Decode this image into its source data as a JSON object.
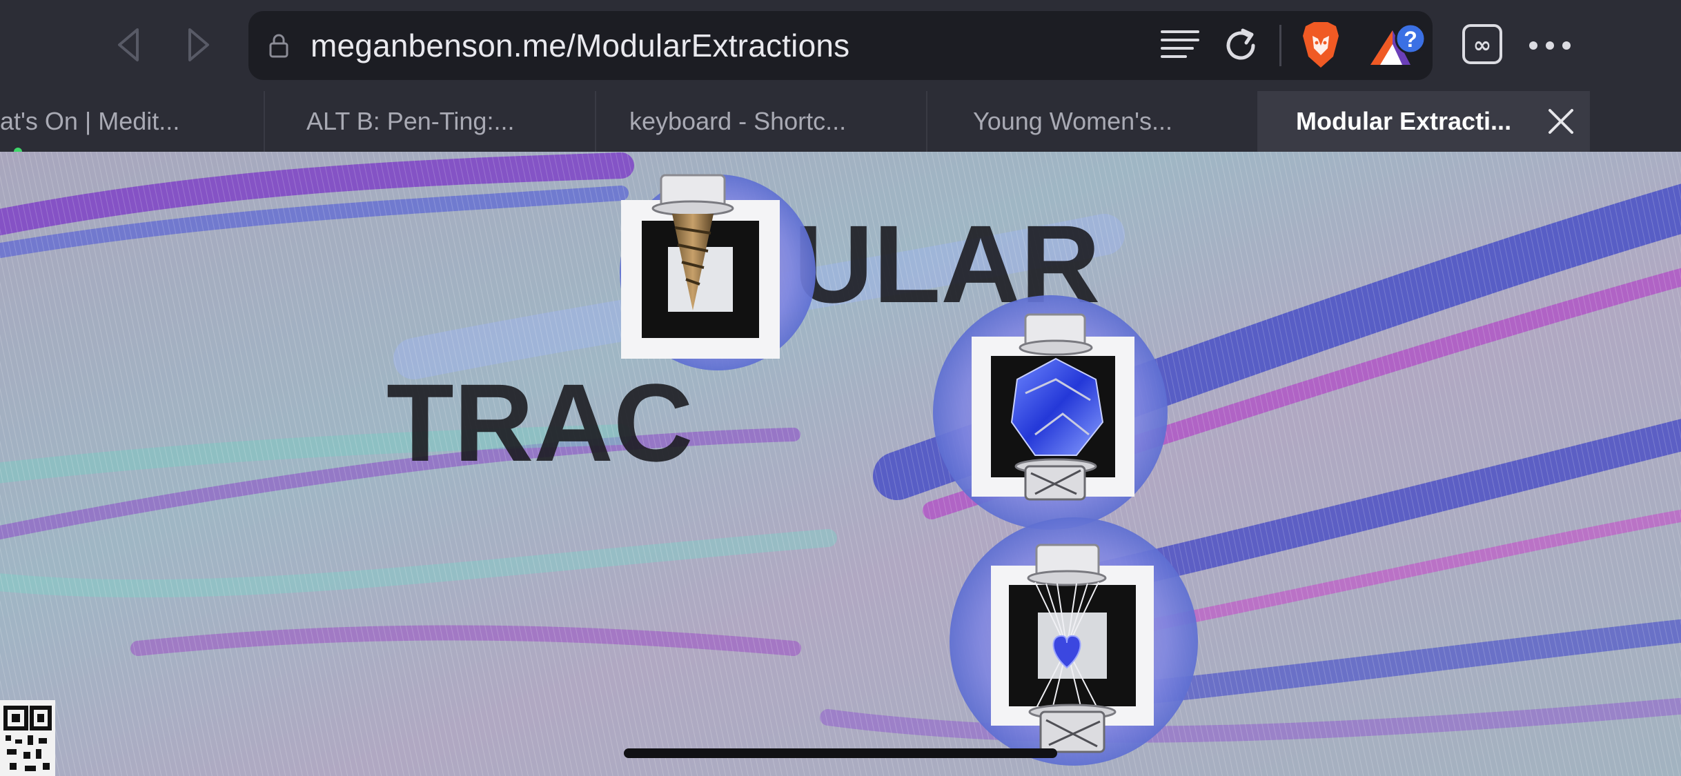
{
  "toolbar": {
    "back_icon": "chevron-left-icon",
    "forward_icon": "chevron-right-icon",
    "url": "meganbenson.me/ModularExtractions",
    "reader_icon": "reader-mode-icon",
    "reload_icon": "reload-icon",
    "shields_icon": "brave-lion-icon",
    "rewards_icon": "brave-rewards-icon",
    "rewards_badge": "?",
    "tabs_icon": "tab-switcher-icon",
    "tabs_label": "∞",
    "menu_icon": "more-horizontal-icon"
  },
  "tabs": [
    {
      "label": "at's On | Medit..."
    },
    {
      "label": "ALT B: Pen-Ting:..."
    },
    {
      "label": "keyboard - Shortc..."
    },
    {
      "label": "Young Women's..."
    },
    {
      "label": "Modular Extracti...",
      "active": true
    }
  ],
  "content": {
    "backdrop_text_top": "ULAR",
    "backdrop_text_bottom": "TRAC"
  },
  "colors": {
    "toolbar_bg": "#2c2d36",
    "urlbar_bg": "#1c1d23",
    "active_tab_bg": "#3a3b45",
    "brave_orange": "#f05a24",
    "rewards_blue": "#3b70e4",
    "backdrop_purple": "#9b4cc9",
    "backdrop_blue": "#3e48c9",
    "backdrop_teal": "#8fc9c6"
  }
}
